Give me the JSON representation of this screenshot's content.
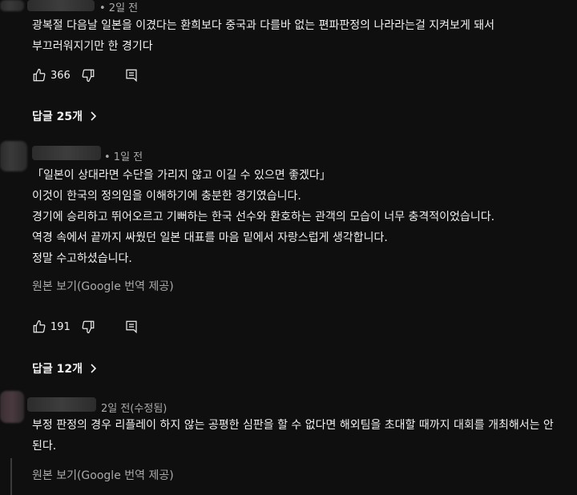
{
  "comments": [
    {
      "meta": "• 2일 전",
      "lines": [
        "광복절 다음날 일본을 이겼다는 환희보다 중국과 다를바 없는 편파판정의 나라라는걸 지켜보게 돼서",
        "부끄러워지기만 한 경기다"
      ],
      "likes": "366",
      "replies_label": "답글 25개"
    },
    {
      "meta": "• 1일 전",
      "lines": [
        "「일본이 상대라면 수단을 가리지 않고 이길 수 있으면 좋겠다」",
        "이것이 한국의 정의임을 이해하기에 충분한 경기였습니다.",
        "경기에 승리하고 뛰어오르고 기뻐하는 한국 선수와 환호하는 관객의 모습이 너무 충격적이었습니다.",
        "역경 속에서 끝까지 싸웠던 일본 대표를 마음 밑에서 자랑스럽게 생각합니다.",
        "정말 수고하셨습니다."
      ],
      "translate_label": "원본 보기(Google 번역 제공)",
      "likes": "191",
      "replies_label": "답글 12개"
    },
    {
      "meta": "2일 전(수정됨)",
      "lines": [
        "부정 판정의 경우 리플레이 하지 않는 공평한 심판을 할 수 없다면 해외팀을 초대할 때까지 대회를 개최해서는 안",
        "된다."
      ],
      "translate_label": "원본 보기(Google 번역 제공)"
    }
  ],
  "icons": {
    "like": "thumbs-up-icon",
    "dislike": "thumbs-down-icon",
    "reply": "reply-icon",
    "chevron": "chevron-right-icon"
  }
}
